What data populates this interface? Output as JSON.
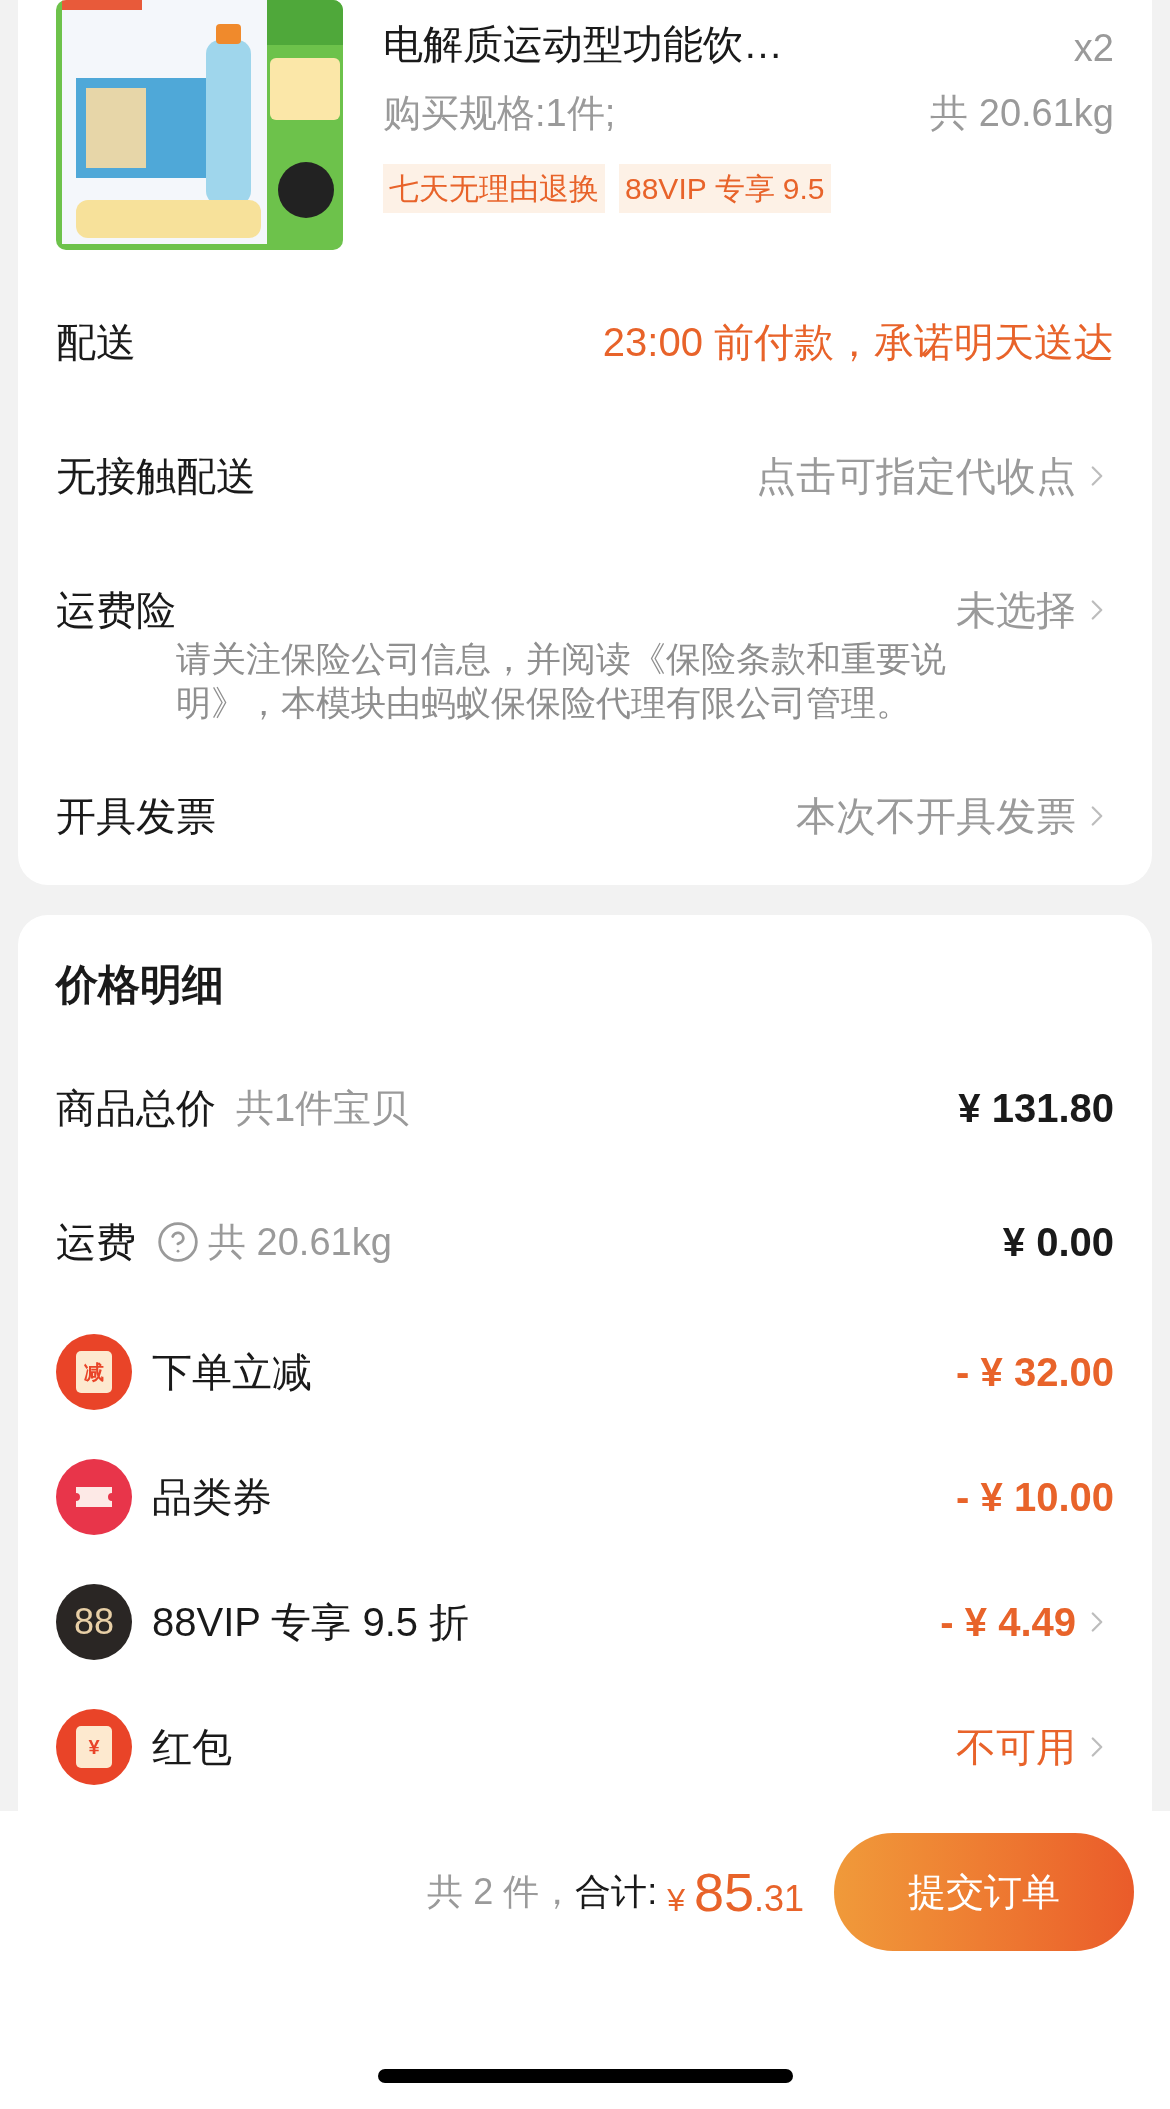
{
  "product": {
    "title": "电解质运动型功能饮…",
    "quantity": "x2",
    "spec": "购买规格:1件;",
    "weight": "共 20.61kg",
    "tags": [
      "七天无理由退换",
      "88VIP 专享 9.5"
    ]
  },
  "order_rows": [
    {
      "kind": "highlight",
      "label": "配送",
      "value": "23:00 前付款，承诺明天送达",
      "chevron": false
    },
    {
      "kind": "option",
      "label": "无接触配送",
      "value": "点击可指定代收点",
      "chevron": true
    },
    {
      "kind": "option",
      "label": "运费险",
      "value": "未选择",
      "chevron": true,
      "note": "请关注保险公司信息，并阅读《保险条款和重要说明》，本模块由蚂蚁保保险代理有限公司管理。"
    },
    {
      "kind": "option",
      "label": "开具发票",
      "value": "本次不开具发票",
      "chevron": true
    }
  ],
  "price_detail": {
    "title": "价格明细",
    "rows": [
      {
        "kind": "total",
        "label": "商品总价",
        "sub": "共1件宝贝",
        "value": "¥ 131.80",
        "chevron": false
      },
      {
        "kind": "total",
        "label": "运费",
        "help": true,
        "sub": "共 20.61kg",
        "value": "¥ 0.00",
        "chevron": false
      },
      {
        "kind": "discount",
        "badge": {
          "kind": "envelope",
          "text": "减"
        },
        "label": "下单立减",
        "value": "- ¥ 32.00",
        "chevron": false
      },
      {
        "kind": "discount",
        "badge": {
          "kind": "ticket"
        },
        "label": "品类券",
        "value": "- ¥ 10.00",
        "chevron": false
      },
      {
        "kind": "discount",
        "badge": {
          "kind": "vip",
          "text": "88"
        },
        "label": "88VIP 专享 9.5 折",
        "value": "- ¥ 4.49",
        "chevron": true
      },
      {
        "kind": "status",
        "badge": {
          "kind": "envelope",
          "text": "¥"
        },
        "label": "红包",
        "value": "不可用",
        "chevron": true
      }
    ]
  },
  "footer": {
    "count": "共 2 件，",
    "total_label": "合计:",
    "currency": "¥",
    "amount": "85",
    "decimals": ".31",
    "submit": "提交订单"
  }
}
